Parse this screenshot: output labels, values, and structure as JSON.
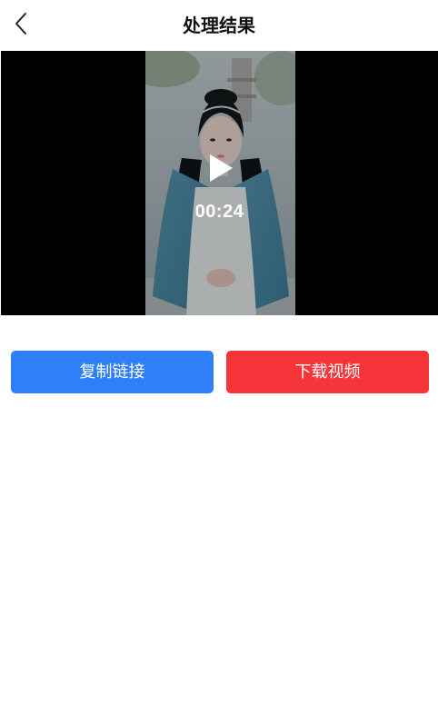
{
  "header": {
    "back_icon": "chevron-left-icon",
    "title": "处理结果"
  },
  "video": {
    "duration": "00:24",
    "play_icon": "play-icon",
    "thumbnail": "woman-in-hanfu-costume"
  },
  "actions": {
    "copy_label": "复制链接",
    "download_label": "下载视频"
  },
  "colors": {
    "copy_button": "#2f7ff8",
    "download_button": "#f6353a",
    "video_background": "#000000"
  }
}
